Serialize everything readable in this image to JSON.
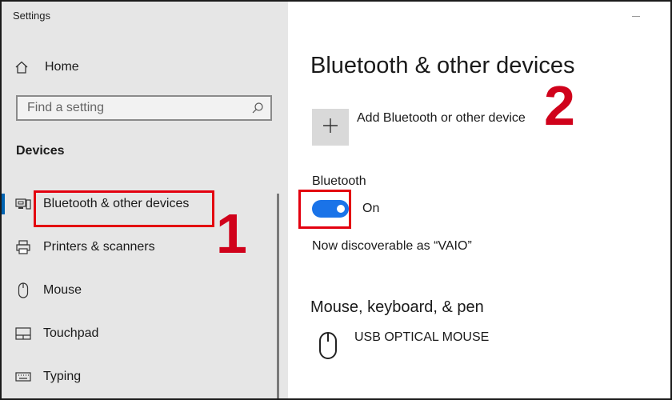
{
  "window": {
    "title": "Settings"
  },
  "sidebar": {
    "home_label": "Home",
    "search_placeholder": "Find a setting",
    "group_label": "Devices",
    "items": [
      {
        "label": "Bluetooth & other devices",
        "icon": "bluetooth-devices-icon",
        "active": true
      },
      {
        "label": "Printers & scanners",
        "icon": "printer-icon"
      },
      {
        "label": "Mouse",
        "icon": "mouse-icon"
      },
      {
        "label": "Touchpad",
        "icon": "touchpad-icon"
      },
      {
        "label": "Typing",
        "icon": "keyboard-icon"
      }
    ]
  },
  "main": {
    "page_title": "Bluetooth & other devices",
    "add_device_label": "Add Bluetooth or other device",
    "bluetooth_label": "Bluetooth",
    "toggle_state": "On",
    "discoverable_text": "Now discoverable as “VAIO”",
    "section_mouse_title": "Mouse, keyboard, & pen",
    "devices": [
      {
        "name": "USB OPTICAL MOUSE",
        "icon": "mouse-icon"
      }
    ]
  },
  "annotations": {
    "step1": "1",
    "step2": "2"
  },
  "colors": {
    "accent": "#0063b1",
    "toggle": "#1a73e8",
    "highlight": "#e3000f",
    "step_number": "#d0021b",
    "sidebar_bg": "#e6e6e6"
  }
}
